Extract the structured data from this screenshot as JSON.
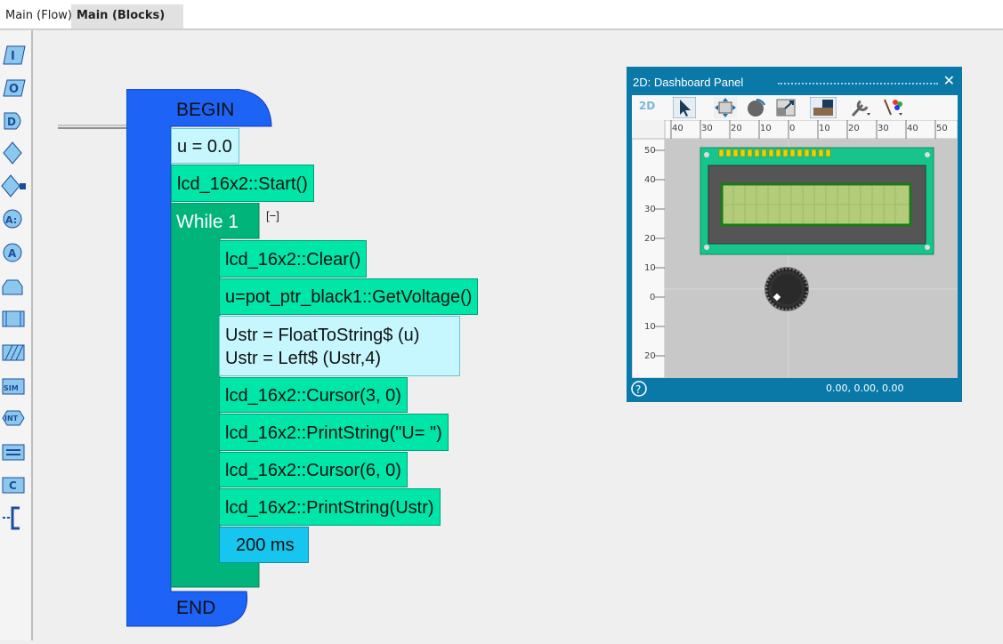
{
  "tabs": [
    {
      "label": "Main (Flow)",
      "active": false
    },
    {
      "label": "Main (Blocks)",
      "active": true,
      "close": "✕"
    }
  ],
  "palette": [
    {
      "name": "input-icon",
      "glyph": "I"
    },
    {
      "name": "output-icon",
      "glyph": "O"
    },
    {
      "name": "delay-icon",
      "glyph": "D"
    },
    {
      "name": "decision-icon",
      "glyph": ""
    },
    {
      "name": "decision-branch-icon",
      "glyph": ""
    },
    {
      "name": "assign-icon",
      "glyph": "A:"
    },
    {
      "name": "action-icon",
      "glyph": "A"
    },
    {
      "name": "loop-icon",
      "glyph": ""
    },
    {
      "name": "subroutine-icon",
      "glyph": ""
    },
    {
      "name": "hatched-block-icon",
      "glyph": ""
    },
    {
      "name": "sim-icon",
      "glyph": "SIM"
    },
    {
      "name": "interrupt-icon",
      "glyph": "INT"
    },
    {
      "name": "equals-icon",
      "glyph": "="
    },
    {
      "name": "comment-icon",
      "glyph": "C"
    },
    {
      "name": "bracket-icon",
      "glyph": ""
    }
  ],
  "program": {
    "begin": "BEGIN",
    "end": "END",
    "init": [
      "u = 0.0",
      "lcd_16x2::Start()"
    ],
    "loop_label": "While 1",
    "collapse": "[−]",
    "body": [
      "lcd_16x2::Clear()",
      "u=pot_ptr_black1::GetVoltage()",
      "Ustr = FloatToString$ (u)",
      "Ustr = Left$ (Ustr,4)",
      "lcd_16x2::Cursor(3, 0)",
      "lcd_16x2::PrintString(\"U= \")",
      "lcd_16x2::Cursor(6, 0)",
      "lcd_16x2::PrintString(Ustr)"
    ],
    "delay": "200 ms"
  },
  "dashboard": {
    "title": "2D: Dashboard Panel",
    "close": "✕",
    "mode": "2D",
    "help": "?",
    "coords": "0.00, 0.00, 0.00",
    "ruler_top": [
      "40",
      "30",
      "20",
      "10",
      "0",
      "10",
      "20",
      "30",
      "40",
      "50"
    ],
    "ruler_left": [
      "50",
      "40",
      "30",
      "20",
      "10",
      "0",
      "10",
      "20"
    ]
  },
  "colors": {
    "begin_blue": "#1d63f5",
    "loop_green": "#00b47a",
    "stmt_green": "#00e6a8",
    "light_cyan": "#c6f7ff",
    "delay_cyan": "#17c6ee",
    "dash_blue": "#0a79a8"
  }
}
